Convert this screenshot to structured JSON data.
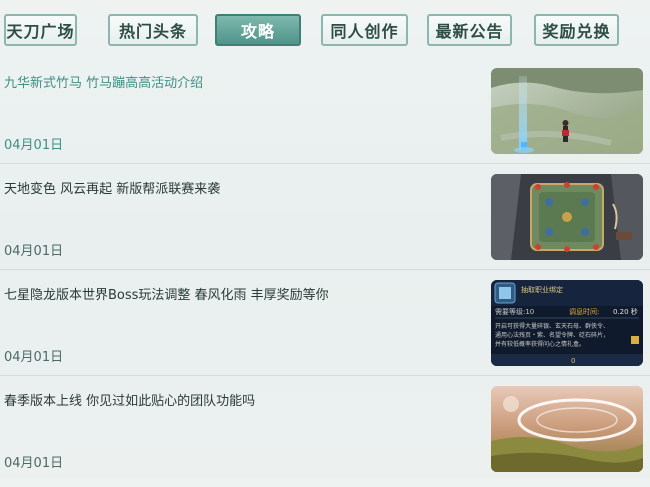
{
  "tabs": [
    {
      "label": "天刀广场",
      "active": false
    },
    {
      "label": "热门头条",
      "active": false
    },
    {
      "label": "攻略",
      "active": true
    },
    {
      "label": "同人创作",
      "active": false
    },
    {
      "label": "最新公告",
      "active": false
    },
    {
      "label": "奖励兑换",
      "active": false
    }
  ],
  "articles": [
    {
      "title": "九华新式竹马 竹马蹦高高活动介绍",
      "date": "04月01日",
      "thumb": "character-in-snowy-field"
    },
    {
      "title": "天地变色 风云再起 新版帮派联赛来袭",
      "date": "04月01日",
      "thumb": "guild-battle-map"
    },
    {
      "title": "七星隐龙版本世界Boss玩法调整 春风化雨 丰厚奖励等你",
      "date": "04月01日",
      "thumb": "game-dialog-screenshot",
      "thumb_text": {
        "header": "抽取职业绑定",
        "level_label": "需要等级:10",
        "time_label": "调息时间:",
        "time_value": "0.20 秒",
        "desc1": "开启可获得大量碎银、玄天石母、群侠令、",
        "desc2": "通用心法残页・紫、名望令牌、砭石碎片，",
        "desc3": "并有较低概率获得问心之情礼盒。",
        "count": "0"
      }
    },
    {
      "title": "春季版本上线 你见过如此贴心的团队功能吗",
      "date": "04月01日",
      "thumb": "swirling-sky-landscape"
    }
  ],
  "colors": {
    "accent": "#4f958a",
    "tab_border": "#8cb6ae",
    "first_item_text": "#3f8f86"
  }
}
